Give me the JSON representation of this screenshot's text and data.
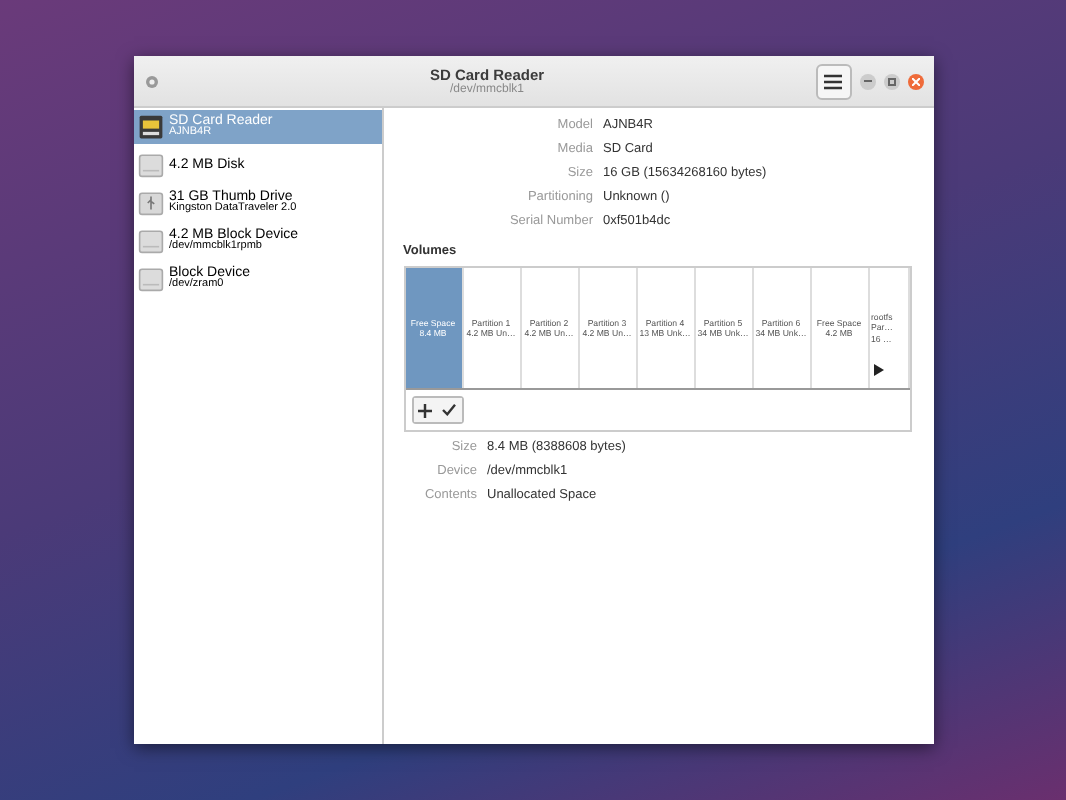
{
  "window": {
    "title": "SD Card Reader",
    "subtitle": "/dev/mmcblk1"
  },
  "sidebar": {
    "items": [
      {
        "kind": "sdcard",
        "title": "SD Card Reader",
        "subtitle": "AJNB4R",
        "selected": true
      },
      {
        "kind": "disk",
        "title": "4.2 MB Disk",
        "selected": false
      },
      {
        "kind": "usb",
        "title": "31 GB Thumb Drive",
        "subtitle": "Kingston DataTraveler 2.0",
        "selected": false
      },
      {
        "kind": "disk",
        "title": "4.2 MB Block Device",
        "subtitle": "/dev/mmcblk1rpmb",
        "selected": false
      },
      {
        "kind": "disk",
        "title": "Block Device",
        "subtitle": "/dev/zram0",
        "selected": false
      }
    ]
  },
  "drive_info": [
    {
      "label": "Model",
      "value": "AJNB4R"
    },
    {
      "label": "Media",
      "value": "SD Card"
    },
    {
      "label": "Size",
      "value": "16 GB (15634268160 bytes)"
    },
    {
      "label": "Partitioning",
      "value": "Unknown ()"
    },
    {
      "label": "Serial Number",
      "value": "0xf501b4dc"
    }
  ],
  "volumes": {
    "title": "Volumes",
    "segments": [
      {
        "lines": [
          "Free Space",
          "8.4 MB"
        ],
        "selected": true
      },
      {
        "lines": [
          "Partition 1",
          "4.2 MB Un…"
        ],
        "selected": false
      },
      {
        "lines": [
          "Partition 2",
          "4.2 MB Un…"
        ],
        "selected": false
      },
      {
        "lines": [
          "Partition 3",
          "4.2 MB Un…"
        ],
        "selected": false
      },
      {
        "lines": [
          "Partition 4",
          "13 MB Unk…"
        ],
        "selected": false
      },
      {
        "lines": [
          "Partition 5",
          "34 MB Unk…"
        ],
        "selected": false
      },
      {
        "lines": [
          "Partition 6",
          "34 MB Unk…"
        ],
        "selected": false
      },
      {
        "lines": [
          "Free Space",
          "4.2 MB"
        ],
        "selected": false
      },
      {
        "lines": [
          "rootfs",
          "Par…",
          "16 …"
        ],
        "selected": false,
        "mounted": true
      }
    ],
    "toolbar": [
      {
        "kind": "add"
      },
      {
        "kind": "check"
      }
    ]
  },
  "volume_info": [
    {
      "label": "Size",
      "value": "8.4 MB (8388608 bytes)"
    },
    {
      "label": "Device",
      "value": "/dev/mmcblk1"
    },
    {
      "label": "Contents",
      "value": "Unallocated Space"
    }
  ]
}
